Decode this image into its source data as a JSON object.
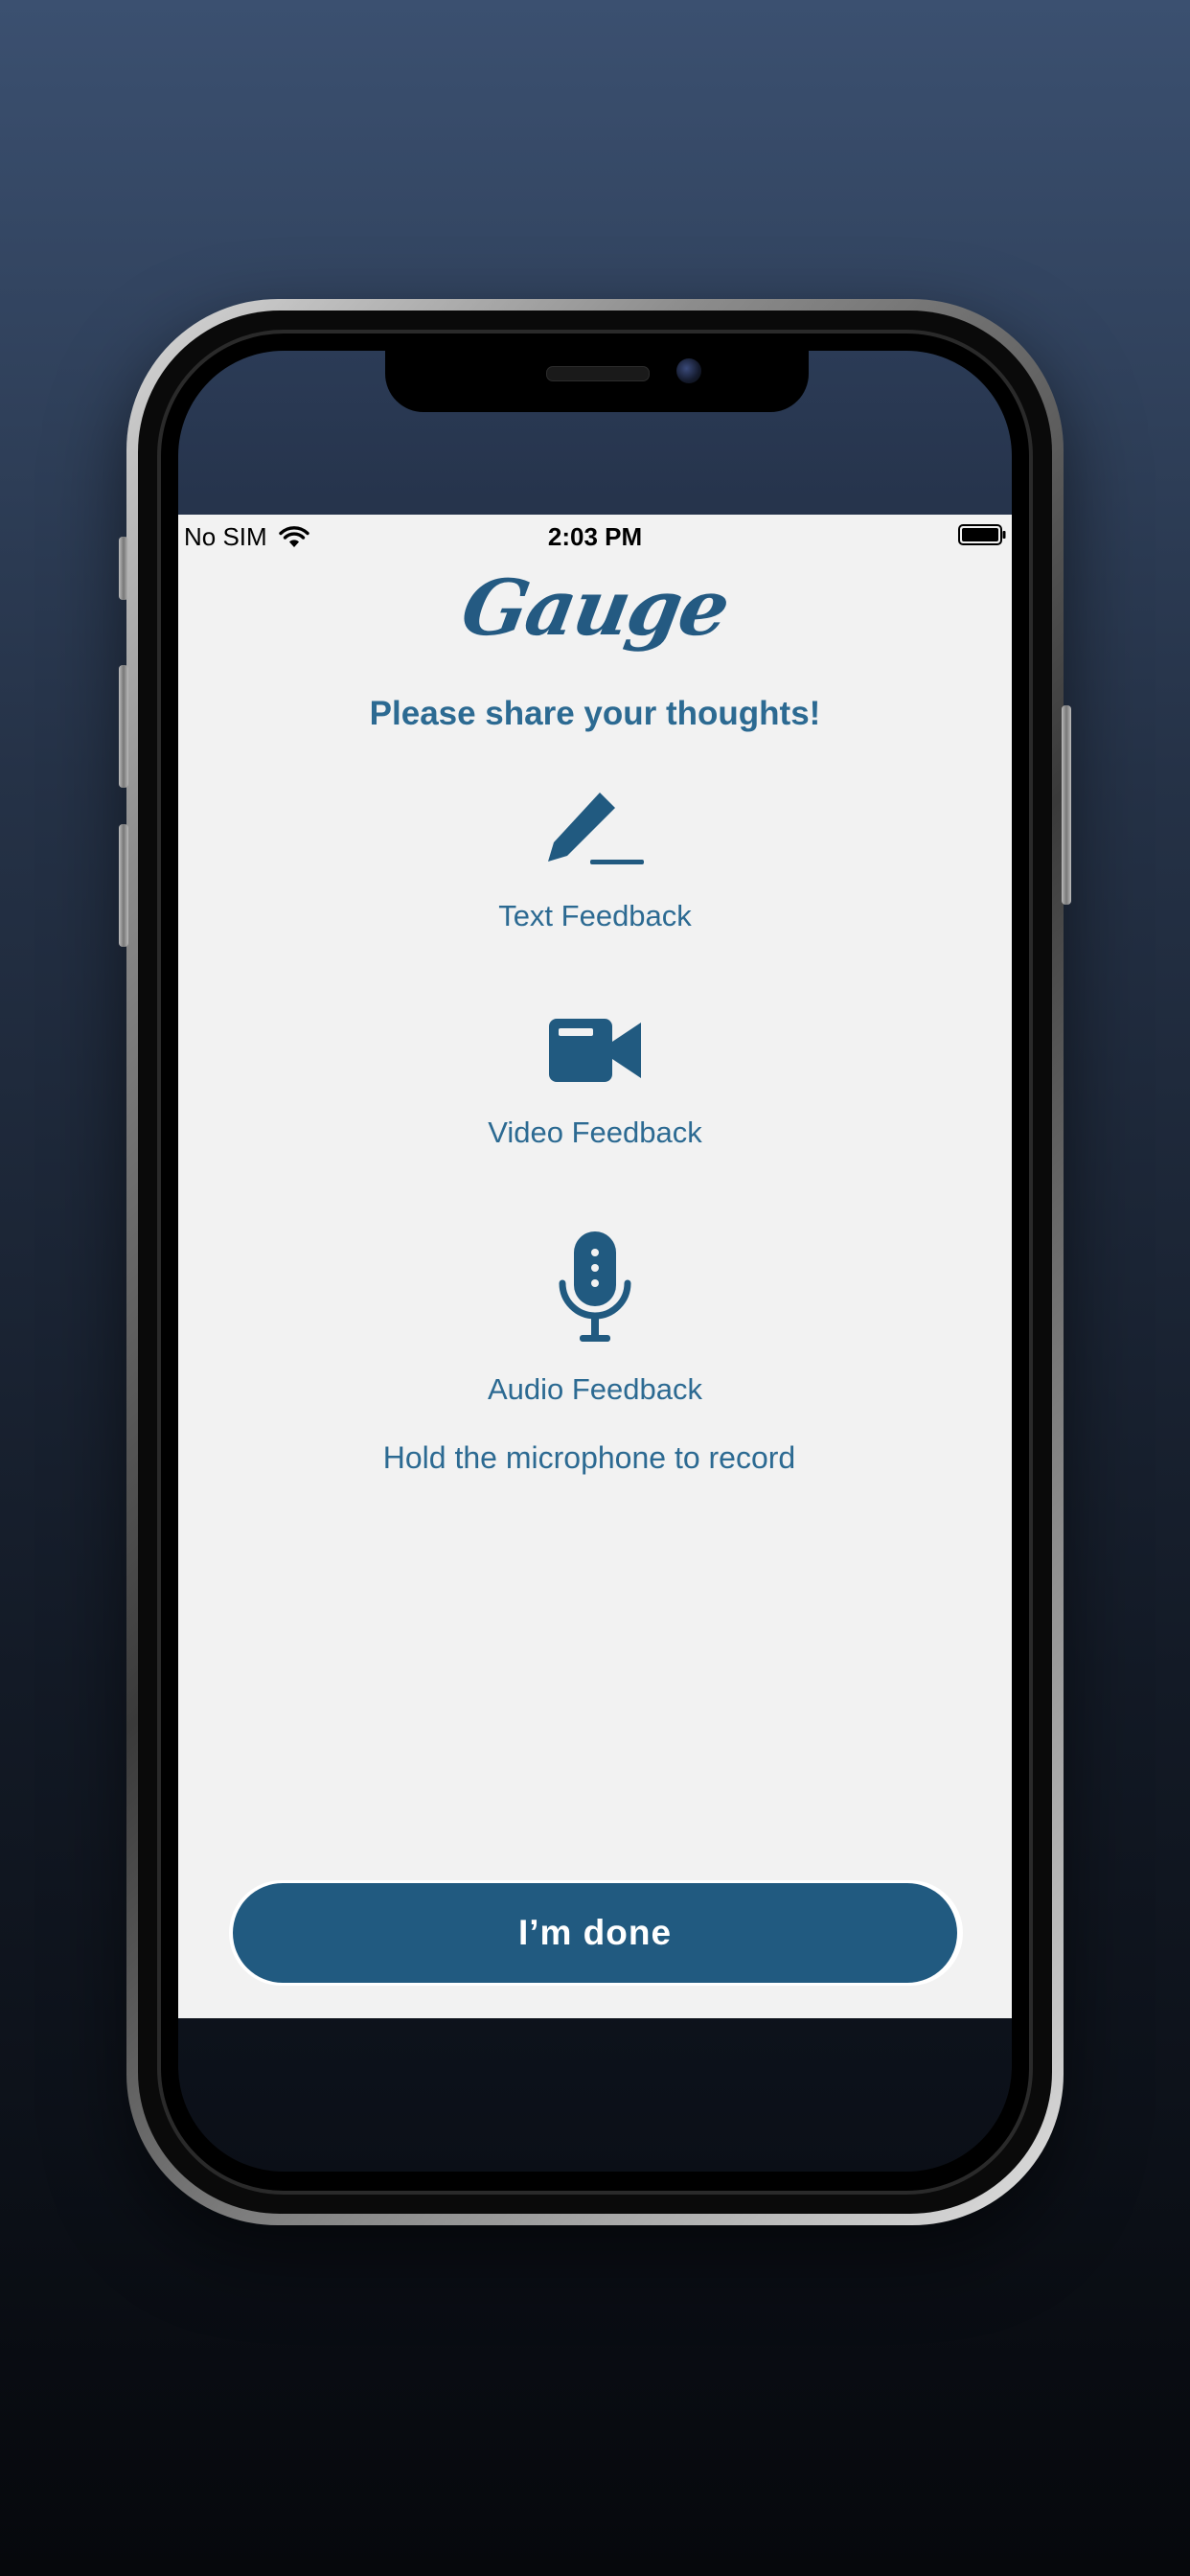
{
  "status_bar": {
    "carrier": "No SIM",
    "time": "2:03 PM"
  },
  "app": {
    "logo": "Gauge",
    "prompt": "Please share your thoughts!",
    "options": [
      {
        "label": "Text Feedback",
        "icon": "pencil-icon"
      },
      {
        "label": "Video Feedback",
        "icon": "video-camera-icon"
      },
      {
        "label": "Audio Feedback",
        "icon": "microphone-icon"
      }
    ],
    "hint": "Hold the microphone to record",
    "done_label": "I’m done"
  },
  "colors": {
    "accent": "#215a80",
    "text": "#2c6a92",
    "background": "#f2f2f2"
  }
}
